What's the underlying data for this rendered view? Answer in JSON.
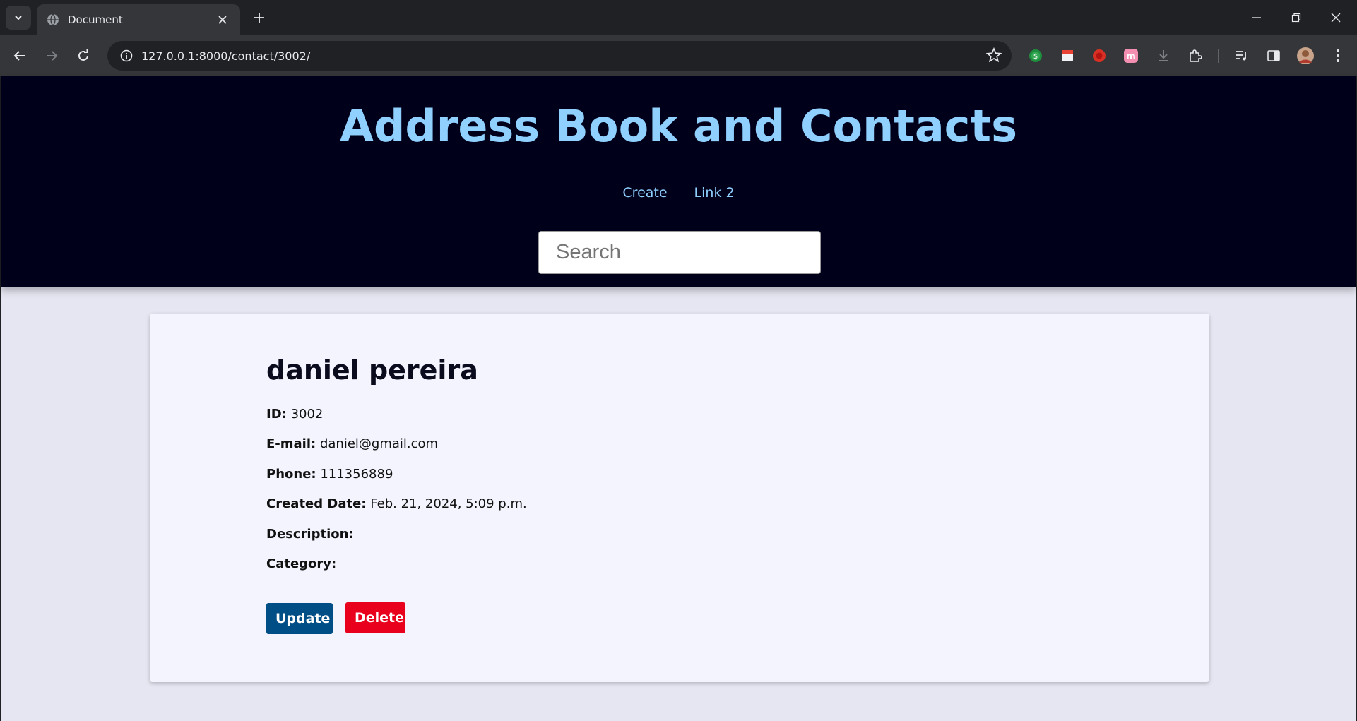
{
  "browser": {
    "tab_title": "Document",
    "url": "127.0.0.1:8000/contact/3002/"
  },
  "header": {
    "title": "Address Book and Contacts",
    "nav": {
      "create": "Create",
      "link2": "Link 2"
    },
    "search_placeholder": "Search"
  },
  "contact": {
    "name": "daniel pereira",
    "id_label": "ID:",
    "id_value": "3002",
    "email_label": "E-mail:",
    "email_value": "daniel@gmail.com",
    "phone_label": "Phone:",
    "phone_value": "111356889",
    "created_label": "Created Date:",
    "created_value": "Feb. 21, 2024, 5:09 p.m.",
    "description_label": "Description:",
    "description_value": "",
    "category_label": "Category:",
    "category_value": ""
  },
  "actions": {
    "update_label": "Update",
    "delete_label": "Delete"
  },
  "colors": {
    "header_bg": "#00001a",
    "accent_text": "#8fd0ff",
    "update_bg": "#004e86",
    "delete_bg": "#e8001c",
    "page_bg": "#e6e6f2",
    "card_bg": "#f3f4fd"
  },
  "icons": {
    "tabstrip": [
      "chevron-down-icon",
      "globe-icon",
      "close-icon",
      "plus-icon",
      "minimize-icon",
      "restore-icon",
      "close-window-icon"
    ],
    "toolbar": [
      "back-icon",
      "forward-icon",
      "reload-icon",
      "info-icon",
      "star-icon",
      "extension-dollar-icon",
      "extension-calendar-icon",
      "extension-record-icon",
      "extension-m-icon",
      "download-icon",
      "puzzle-icon",
      "media-icon",
      "side-panel-icon",
      "profile-avatar-icon",
      "menu-icon"
    ]
  }
}
